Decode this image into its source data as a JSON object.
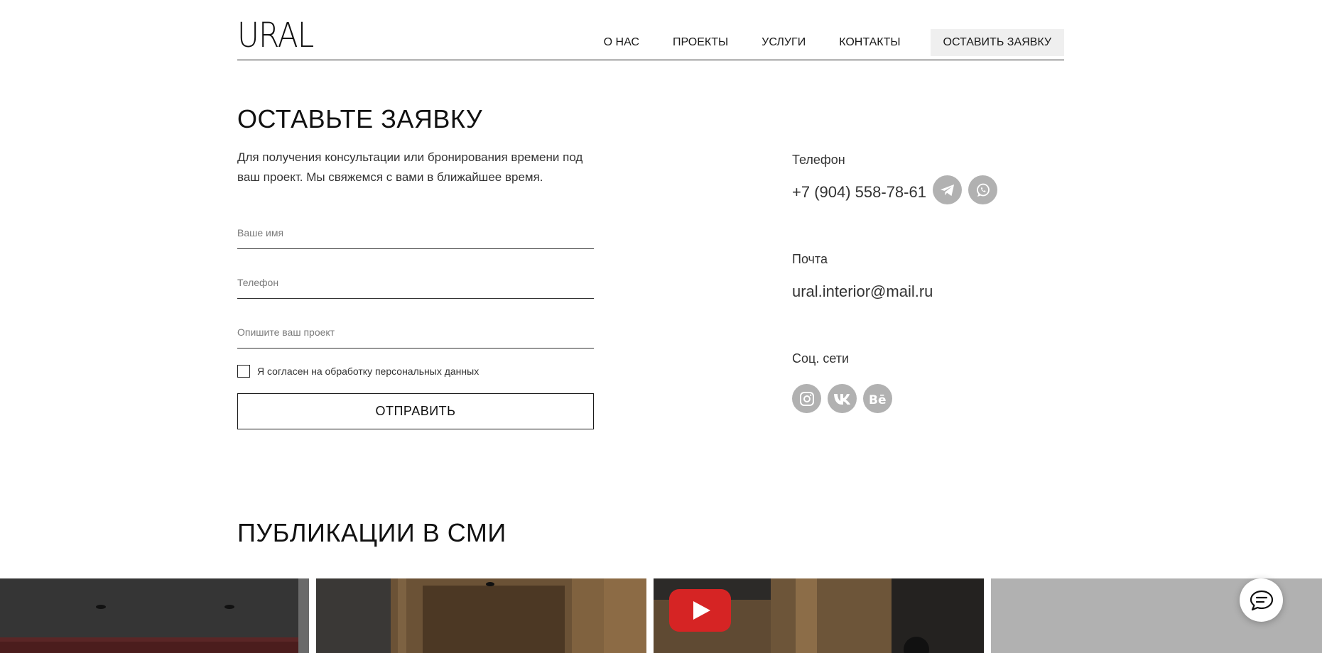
{
  "header": {
    "logo": "URAL",
    "nav": [
      {
        "label": "О НАС"
      },
      {
        "label": "ПРОЕКТЫ"
      },
      {
        "label": "УСЛУГИ"
      },
      {
        "label": "КОНТАКТЫ"
      }
    ],
    "cta_label": "ОСТАВИТЬ ЗАЯВКУ"
  },
  "form": {
    "title": "ОСТАВЬТЕ ЗАЯВКУ",
    "lead": "Для получения консультации или бронирования времени под ваш проект. Мы свяжемся с вами в ближайшее время.",
    "name_placeholder": "Ваше имя",
    "phone_placeholder": "Телефон",
    "project_placeholder": "Опишите ваш проект",
    "consent_label": "Я согласен на обработку персональных данных",
    "submit_label": "ОТПРАВИТЬ"
  },
  "contacts": {
    "phone_label": "Телефон",
    "phone_value": "+7 (904) 558-78-61",
    "email_label": "Почта",
    "email_value": "ural.interior@mail.ru",
    "social_label": "Соц. сети",
    "messengers": [
      "telegram-icon",
      "whatsapp-icon"
    ],
    "socials": [
      "instagram-icon",
      "vk-icon",
      "behance-icon"
    ]
  },
  "publications": {
    "title": "ПУБЛИКАЦИИ В СМИ"
  },
  "colors": {
    "text": "#1a1a1a",
    "icon_gray": "#b1b1b1",
    "cta_bg": "#efefef",
    "youtube_red": "#d62424"
  }
}
